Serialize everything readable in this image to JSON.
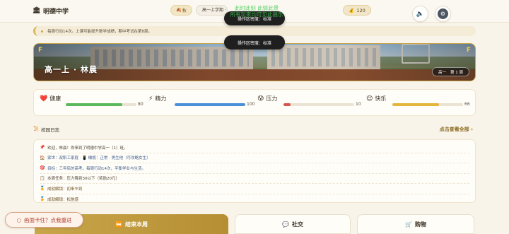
{
  "header": {
    "school_name": "明德中学",
    "school_icon": "school-building-icon",
    "season_label": "秋",
    "grade_text": "高一上学期 · 第1周",
    "coins": "120",
    "sound_icon": "speaker-icon",
    "settings_icon": "gear-icon"
  },
  "overlay": {
    "watermark_line1": "此时此刻 此情此景",
    "watermark_line2": "所有玩家均可见此提示",
    "toast_1": "操作区密度：标准",
    "toast_2": "操作区密度：标准"
  },
  "hint": {
    "text": "每周行动14次。上课可能提升数学成绩，期中考试在第8周。"
  },
  "banner": {
    "player_name": "高一上 · 林晨",
    "term": "高一",
    "week": "第 1 周",
    "corner_left": "F",
    "corner_right": "F"
  },
  "stats": [
    {
      "label": "健康",
      "icon": "❤️",
      "value": "80",
      "percent": 0.8,
      "color": "#5cb85c"
    },
    {
      "label": "精力",
      "icon": "⚡",
      "value": "100",
      "percent": 1.0,
      "color": "#4a90d9"
    },
    {
      "label": "压力",
      "icon": "😰",
      "value": "10",
      "percent": 0.1,
      "color": "#d9534f"
    },
    {
      "label": "快乐",
      "icon": "😊",
      "value": "66",
      "percent": 0.66,
      "color": "#e3b53a"
    }
  ],
  "log": {
    "title": "校园日志",
    "title_icon": "📜",
    "view_all": "点击查看全部 ›",
    "entries": [
      {
        "icon": "📌",
        "text": "欢迎，林晨！你来到了明德中学高一（1）班。",
        "tone": "plain"
      },
      {
        "icon": "🏠",
        "text": "家世：双职工家庭 · 📱 橄榄：正常 · 男生他（可攻略女生）",
        "tone": "blue"
      },
      {
        "icon": "🎯",
        "text": "目标：三年后的高考。每周行动14次，平衡学业与生活。",
        "tone": "blue"
      },
      {
        "icon": "📋",
        "text": "本周任务：压力降到30以下（奖励20元）",
        "tone": "plain"
      },
      {
        "icon": "🏅",
        "text": "成就解锁：初来乍到",
        "tone": "brown"
      },
      {
        "icon": "🏅",
        "text": "成就解锁：松弛感",
        "tone": "brown"
      }
    ]
  },
  "actions": {
    "end_week": "结束本周",
    "end_week_icon": "⏭️",
    "social": "社交",
    "social_icon": "💬",
    "shop": "购物",
    "shop_icon": "🛒"
  },
  "retry": {
    "text": "画面卡住？点我重进",
    "icon": "○"
  }
}
